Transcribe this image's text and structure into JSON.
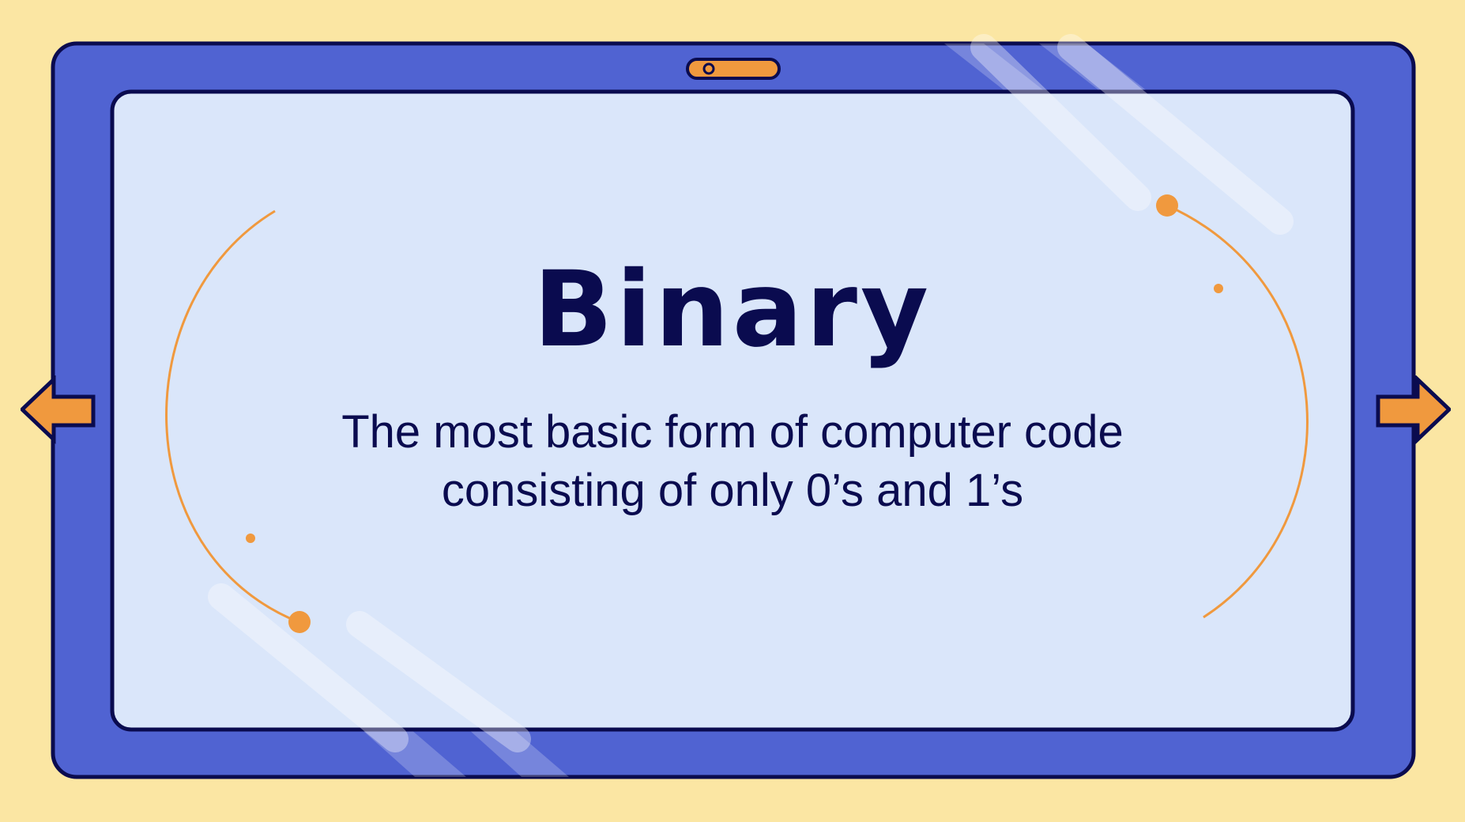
{
  "slide": {
    "title": "Binary",
    "subtitle_line1": "The most basic form of computer code",
    "subtitle_line2": "consisting of only 0’s and 1’s"
  },
  "navigation": {
    "prev_icon": "arrow-left-icon",
    "next_icon": "arrow-right-icon"
  },
  "decor": {
    "camera_icon": "webcam-icon"
  },
  "colors": {
    "background": "#fbe6a3",
    "frame": "#5063d2",
    "screen": "#dae6fa",
    "outline": "#0a0b4f",
    "accent": "#f0993e"
  }
}
